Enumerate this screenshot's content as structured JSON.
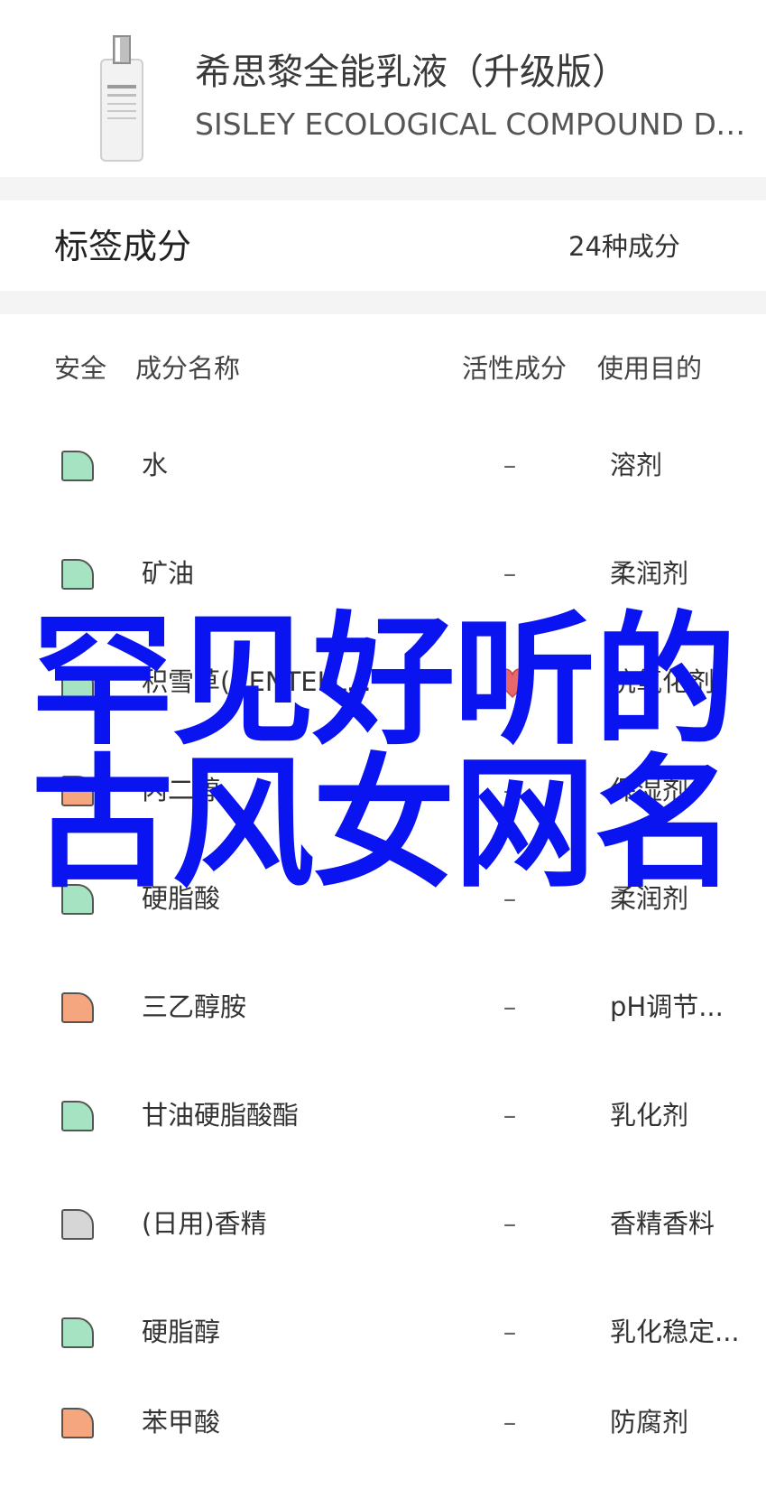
{
  "product": {
    "name": "希思黎全能乳液（升级版）",
    "english_name": "SISLEY ECOLOGICAL COMPOUND DAY...",
    "image_icon": "product-bottle-image"
  },
  "tags": {
    "title": "标签成分",
    "count": "24种成分"
  },
  "columns": {
    "safety": "安全",
    "name": "成分名称",
    "active": "活性成分",
    "purpose": "使用目的"
  },
  "colors": {
    "safe_green": "#a6e3c2",
    "caution_orange": "#f5a67f",
    "unknown_gray": "#d6d6d6",
    "heart_red": "#e8686a",
    "overlay_blue": "#0a14f0"
  },
  "ingredients": [
    {
      "name": "水",
      "active": "–",
      "purpose": "溶剂",
      "safety": "safe"
    },
    {
      "name": "矿油",
      "active": "–",
      "purpose": "柔润剂",
      "safety": "safe"
    },
    {
      "name": "积雪草(CENTELL...",
      "active": "heart",
      "purpose": "抗氧化剂",
      "safety": "safe"
    },
    {
      "name": "丙二醇",
      "active": "–",
      "purpose": "保湿剂",
      "safety": "caution"
    },
    {
      "name": "硬脂酸",
      "active": "–",
      "purpose": "柔润剂",
      "safety": "safe"
    },
    {
      "name": "三乙醇胺",
      "active": "–",
      "purpose": "pH调节...",
      "safety": "caution"
    },
    {
      "name": "甘油硬脂酸酯",
      "active": "–",
      "purpose": "乳化剂",
      "safety": "safe"
    },
    {
      "name": "(日用)香精",
      "active": "–",
      "purpose": "香精香料",
      "safety": "unknown"
    },
    {
      "name": "硬脂醇",
      "active": "–",
      "purpose": "乳化稳定...",
      "safety": "safe"
    },
    {
      "name": "苯甲酸",
      "active": "–",
      "purpose": "防腐剂",
      "safety": "caution"
    }
  ],
  "overlay": {
    "line1": "罕见好听的",
    "line2": "古风女网名"
  }
}
